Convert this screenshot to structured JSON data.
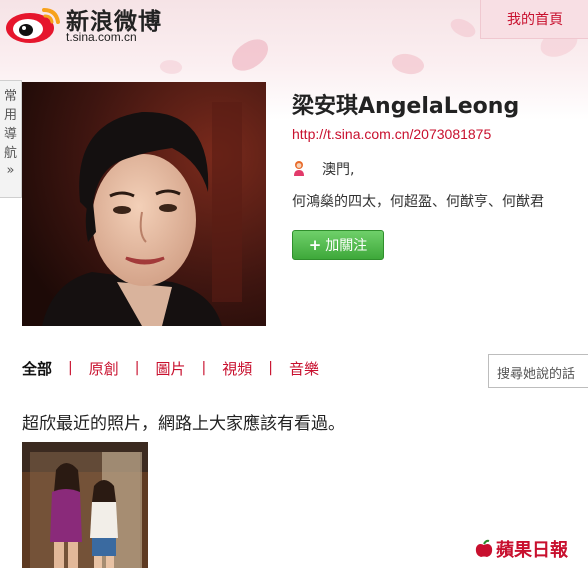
{
  "header": {
    "logo_name": "新浪微博",
    "logo_url": "t.sina.com.cn",
    "home_link": "我的首頁"
  },
  "side_nav": {
    "chars": [
      "常",
      "用",
      "導",
      "航"
    ],
    "arrow": "»"
  },
  "profile": {
    "name": "梁安琪AngelaLeong",
    "url": "http://t.sina.com.cn/2073081875",
    "location": "澳門,",
    "bio": "何鴻燊的四太，何超盈、何猷亨、何猷君",
    "follow_label": "加關注"
  },
  "tabs": [
    {
      "label": "全部",
      "active": true
    },
    {
      "label": "原創",
      "active": false
    },
    {
      "label": "圖片",
      "active": false
    },
    {
      "label": "視頻",
      "active": false
    },
    {
      "label": "音樂",
      "active": false
    }
  ],
  "tab_separator": "|",
  "search": {
    "placeholder": "搜尋她說的話"
  },
  "post": {
    "text": "超欣最近的照片，網路上大家應該有看過。"
  },
  "watermark": {
    "text": "蘋果日報"
  },
  "colors": {
    "accent_red": "#c8102e",
    "follow_green": "#3ea83a"
  }
}
